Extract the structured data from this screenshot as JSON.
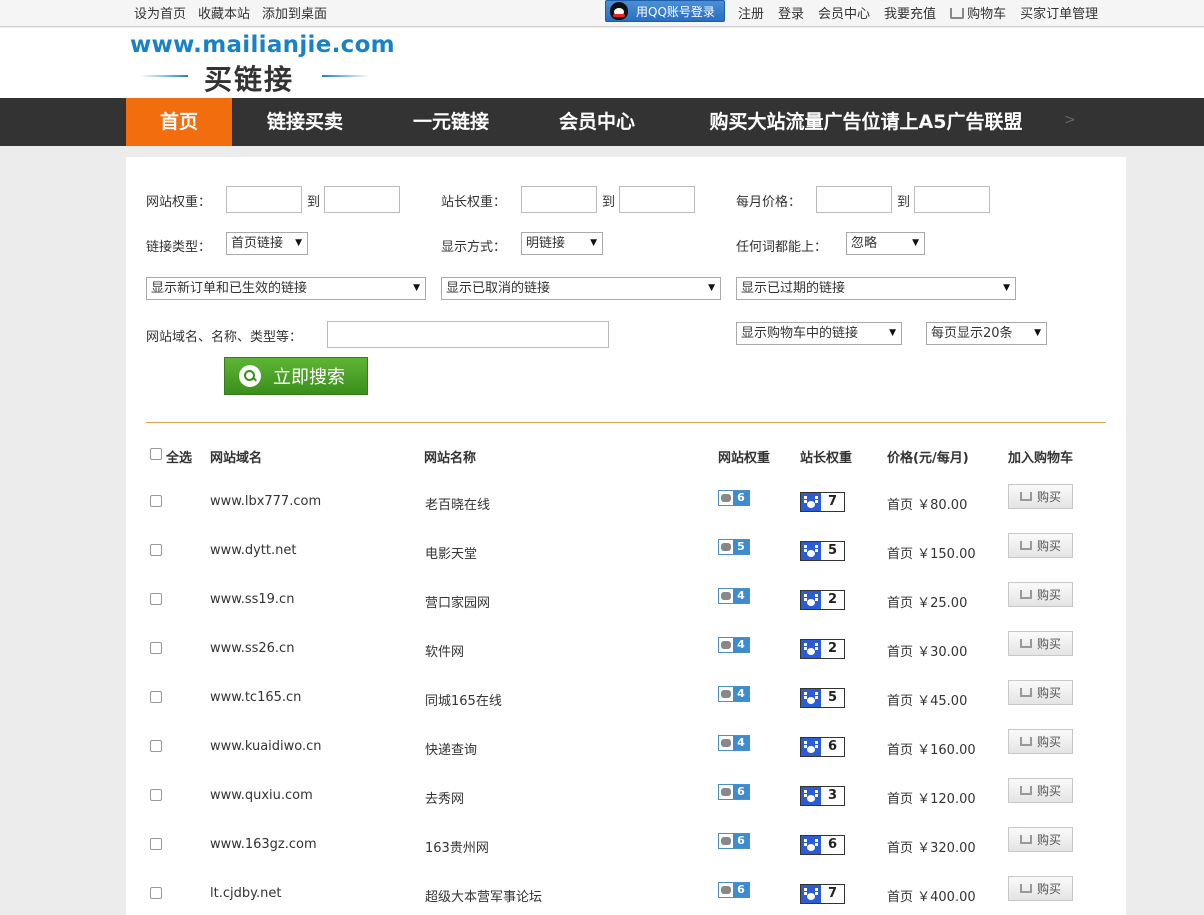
{
  "topbar": {
    "left_links": [
      "设为首页",
      "收藏本站",
      "添加到桌面"
    ],
    "qq_login": "用QQ账号登录",
    "right_links": [
      "注册",
      "登录",
      "会员中心",
      "我要充值"
    ],
    "cart": "购物车",
    "orders": "买家订单管理"
  },
  "logo": {
    "url_text": "www.mailianjie.com",
    "cn_text": "买链接"
  },
  "nav": {
    "items": [
      "首页",
      "链接买卖",
      "一元链接",
      "会员中心",
      "购买大站流量广告位请上A5广告联盟"
    ],
    "more": ">",
    "active_color": "#f26d0d"
  },
  "filters": {
    "site_weight": "网站权重：",
    "to": "到",
    "owner_weight": "站长权重：",
    "monthly_price": "每月价格：",
    "link_type_label": "链接类型：",
    "link_type_value": "首页链接",
    "display_mode_label": "显示方式：",
    "display_mode_value": "明链接",
    "any_word_label": "任何词都能上：",
    "any_word_value": "忽略",
    "select_new": "显示新订单和已生效的链接",
    "select_cancelled": "显示已取消的链接",
    "select_expired": "显示已过期的链接",
    "keyword_label": "网站域名、名称、类型等：",
    "select_cart": "显示购物车中的链接",
    "select_perpage": "每页显示20条",
    "search_button": "立即搜索"
  },
  "table": {
    "headers": {
      "select_all": "全选",
      "domain": "网站域名",
      "name": "网站名称",
      "site_weight": "网站权重",
      "owner_weight": "站长权重",
      "price": "价格(元/每月)",
      "add_cart": "加入购物车"
    },
    "buy_label": "购买",
    "rows": [
      {
        "domain": "www.lbx777.com",
        "name": "老百晓在线",
        "pr": "6",
        "bd": "7",
        "price": "首页 ￥80.00"
      },
      {
        "domain": "www.dytt.net",
        "name": "电影天堂",
        "pr": "5",
        "bd": "5",
        "price": "首页 ￥150.00"
      },
      {
        "domain": "www.ss19.cn",
        "name": "营口家园网",
        "pr": "4",
        "bd": "2",
        "price": "首页 ￥25.00"
      },
      {
        "domain": "www.ss26.cn",
        "name": "软件网",
        "pr": "4",
        "bd": "2",
        "price": "首页 ￥30.00"
      },
      {
        "domain": "www.tc165.cn",
        "name": "同城165在线",
        "pr": "4",
        "bd": "5",
        "price": "首页 ￥45.00"
      },
      {
        "domain": "www.kuaidiwo.cn",
        "name": "快递查询",
        "pr": "4",
        "bd": "6",
        "price": "首页 ￥160.00"
      },
      {
        "domain": "www.quxiu.com",
        "name": "去秀网",
        "pr": "6",
        "bd": "3",
        "price": "首页 ￥120.00"
      },
      {
        "domain": "www.163gz.com",
        "name": "163贵州网",
        "pr": "6",
        "bd": "6",
        "price": "首页 ￥320.00"
      },
      {
        "domain": "lt.cjdby.net",
        "name": "超级大本营军事论坛",
        "pr": "6",
        "bd": "7",
        "price": "首页 ￥400.00"
      }
    ]
  }
}
